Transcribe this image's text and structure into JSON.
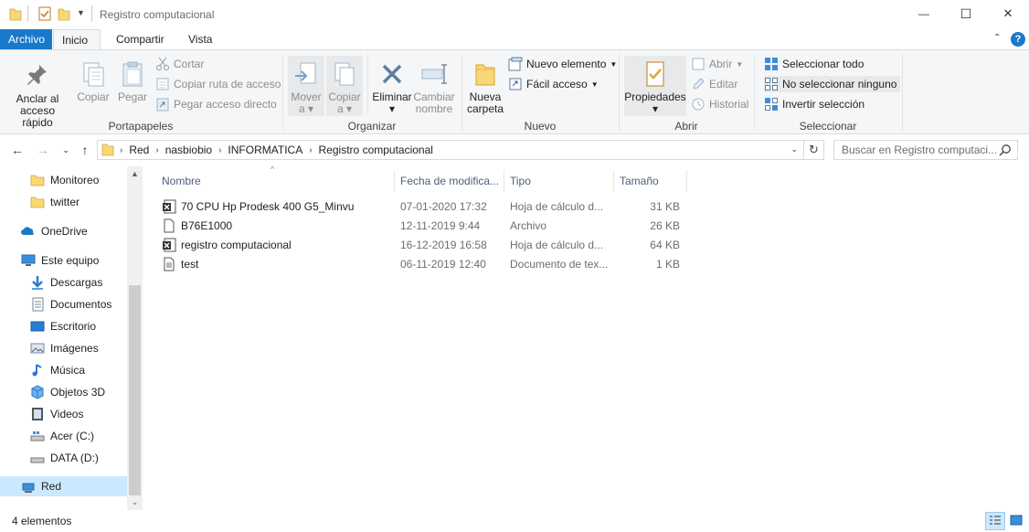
{
  "window": {
    "title": "Registro computacional",
    "minimize_glyph": "—",
    "maximize_glyph": "☐",
    "close_glyph": "✕"
  },
  "ribbon_tabs": {
    "file": "Archivo",
    "home": "Inicio",
    "share": "Compartir",
    "view": "Vista"
  },
  "ribbon": {
    "portapapeles": {
      "label": "Portapapeles",
      "pin": "Anclar al acceso rápido",
      "pin_l1": "Anclar al",
      "pin_l2": "acceso rápido",
      "copy": "Copiar",
      "paste": "Pegar",
      "cut": "Cortar",
      "copy_path": "Copiar ruta de acceso",
      "paste_shortcut": "Pegar acceso directo"
    },
    "organizar": {
      "label": "Organizar",
      "move_l1": "Mover",
      "move_l2": "a",
      "copy_l1": "Copiar",
      "copy_l2": "a",
      "delete": "Eliminar",
      "rename_l1": "Cambiar",
      "rename_l2": "nombre"
    },
    "nuevo": {
      "label": "Nuevo",
      "folder_l1": "Nueva",
      "folder_l2": "carpeta",
      "new_item": "Nuevo elemento",
      "easy_access": "Fácil acceso"
    },
    "abrir": {
      "label": "Abrir",
      "properties": "Propiedades",
      "open": "Abrir",
      "edit": "Editar",
      "history": "Historial"
    },
    "seleccionar": {
      "label": "Seleccionar",
      "select_all": "Seleccionar todo",
      "select_none": "No seleccionar ninguno",
      "invert": "Invertir selección"
    }
  },
  "address": {
    "crumbs": [
      "Red",
      "nasbiobio",
      "INFORMATICA",
      "Registro computacional"
    ],
    "search_placeholder": "Buscar en Registro computaci..."
  },
  "nav": {
    "items": [
      {
        "label": "Monitoreo",
        "icon": "folder-icon"
      },
      {
        "label": "twitter",
        "icon": "folder-icon"
      },
      {
        "label": "OneDrive",
        "icon": "onedrive-icon"
      },
      {
        "label": "Este equipo",
        "icon": "computer-icon"
      },
      {
        "label": "Descargas",
        "icon": "downloads-icon"
      },
      {
        "label": "Documentos",
        "icon": "documents-icon"
      },
      {
        "label": "Escritorio",
        "icon": "desktop-icon"
      },
      {
        "label": "Imágenes",
        "icon": "pictures-icon"
      },
      {
        "label": "Música",
        "icon": "music-icon"
      },
      {
        "label": "Objetos 3D",
        "icon": "3d-objects-icon"
      },
      {
        "label": "Videos",
        "icon": "videos-icon"
      },
      {
        "label": "Acer (C:)",
        "icon": "drive-icon"
      },
      {
        "label": "DATA (D:)",
        "icon": "drive-icon"
      },
      {
        "label": "Red",
        "icon": "network-icon"
      }
    ]
  },
  "columns": {
    "name": "Nombre",
    "date": "Fecha de modifica...",
    "type": "Tipo",
    "size": "Tamaño"
  },
  "files": [
    {
      "name": "70 CPU Hp Prodesk 400 G5_Minvu",
      "date": "07-01-2020 17:32",
      "type": "Hoja de cálculo d...",
      "size": "31 KB",
      "icon": "excel-file-icon"
    },
    {
      "name": "B76E1000",
      "date": "12-11-2019 9:44",
      "type": "Archivo",
      "size": "26 KB",
      "icon": "file-icon"
    },
    {
      "name": "registro computacional",
      "date": "16-12-2019 16:58",
      "type": "Hoja de cálculo d...",
      "size": "64 KB",
      "icon": "excel-file-icon"
    },
    {
      "name": "test",
      "date": "06-11-2019 12:40",
      "type": "Documento de tex...",
      "size": "1 KB",
      "icon": "text-file-icon"
    }
  ],
  "status": {
    "count": "4 elementos"
  },
  "colors": {
    "accent": "#1979ca",
    "selected_bg": "#cce8ff",
    "ribbon_bg": "#f5f6f7",
    "folder": "#f8d775"
  }
}
